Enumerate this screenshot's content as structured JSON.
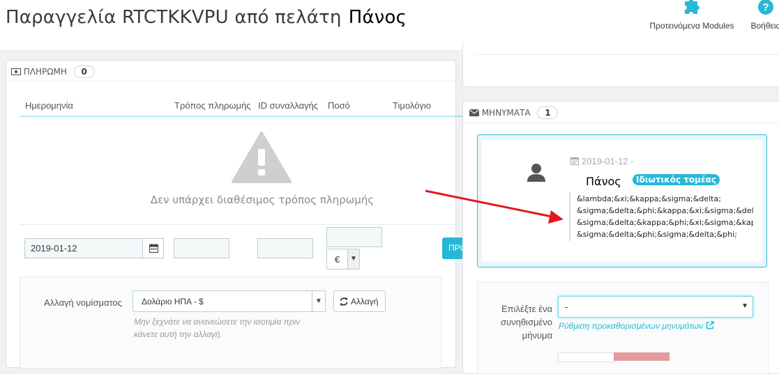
{
  "header": {
    "title": "Παραγγελία RTCTKKVPU από πελάτη",
    "customer": "Πάνος",
    "modules_label": "Προτεινόμενα Modules",
    "help_label": "Βοήθεια"
  },
  "payment": {
    "title": "ΠΛΗΡΩΜΗ",
    "count": "0",
    "columns": [
      "Ημερομηνία",
      "Τρόπος πληρωμής",
      "ID συναλλαγής",
      "Ποσό",
      "Τιμολόγιο"
    ],
    "empty_text": "Δεν υπάρχει διαθέσιμος τρόπος πληρωμής",
    "date_value": "2019-01-12",
    "currency_symbol": "€",
    "add_button_partial": "ΠΡΟ"
  },
  "currency": {
    "label": "Αλλαγή νομίσματος",
    "selected": "Δολάριο ΗΠΑ - $",
    "change_button": "Αλλαγή",
    "note": "Μην ξεχνάτε να ανανεώσετε την ισοτιμία πριν κάνετε αυτή την αλλαγή."
  },
  "messages": {
    "title": "ΜΗΝΥΜΑΤΑ",
    "count": "1",
    "date": "2019-01-12 -",
    "author": "Πάνος",
    "tag": "Ιδιωτικός τομέας",
    "lines": [
      "&lambda;&xi;&kappa;&sigma;&delta;",
      "&sigma;&delta;&phi;&kappa;&xi;&sigma;&delta;",
      "&sigma;&delta;&kappa;&phi;&xi;&sigma;&kappa;",
      "&sigma;&delta;&phi;&sigma;&delta;&phi;"
    ],
    "choose_label": "Επιλέξτε ένα συνηθισμένο μήνυμα",
    "choose_value": "-",
    "configure_link": "Ρύθμιση προκαθορισμένων μηνυμάτων"
  },
  "colors": {
    "accent": "#25b9d7",
    "annotation_arrow": "#e8141b"
  }
}
